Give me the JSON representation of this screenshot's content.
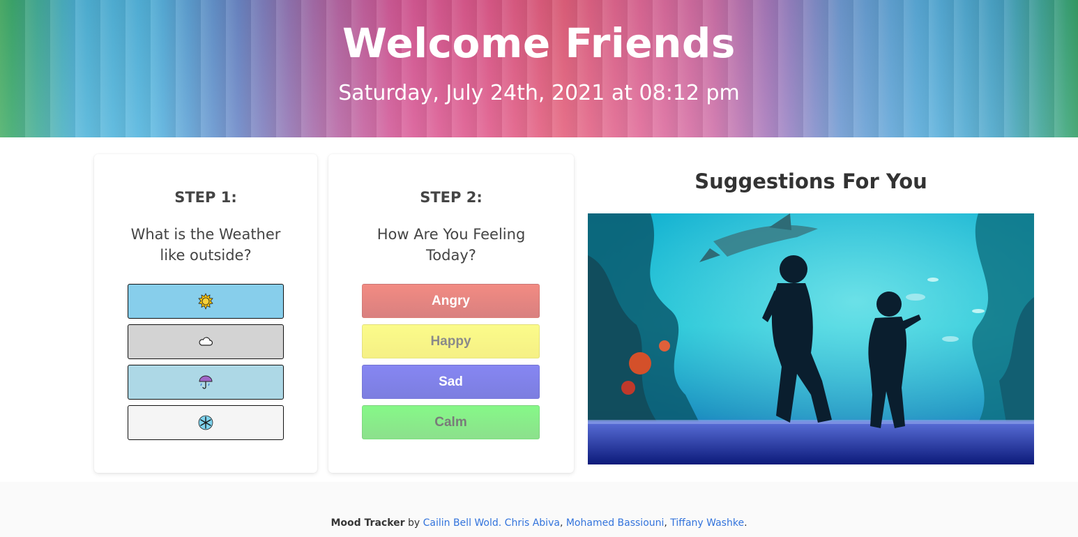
{
  "header": {
    "title": "Welcome Friends",
    "date": "Saturday, July 24th, 2021 at 08:12 pm"
  },
  "step1": {
    "title": "STEP 1:",
    "question_line1": "What is the Weather",
    "question_line2": "like outside?",
    "options": [
      {
        "icon": "sun-icon",
        "glyph": "🌞",
        "color": "#87ceeb"
      },
      {
        "icon": "cloud-icon",
        "glyph": "☁",
        "color": "#d3d3d3"
      },
      {
        "icon": "umbrella-rain-icon",
        "glyph": "☔",
        "color": "#add8e6"
      },
      {
        "icon": "snowflake-icon",
        "glyph": "❄",
        "color": "#f5f5f5"
      }
    ]
  },
  "step2": {
    "title": "STEP 2:",
    "question_line1": "How Are You Feeling",
    "question_line2": "Today?",
    "moods": [
      {
        "label": "Angry",
        "color": "#f28b82"
      },
      {
        "label": "Happy",
        "color": "#fbfb8a"
      },
      {
        "label": "Sad",
        "color": "#8686f2"
      },
      {
        "label": "Calm",
        "color": "#86f888"
      }
    ]
  },
  "suggestions": {
    "title": "Suggestions For You"
  },
  "footer": {
    "app_name": "Mood Tracker",
    "by": "by",
    "authors": [
      "Cailin Bell Wold.",
      "Chris Abiva",
      "Mohamed Bassiouni",
      "Tiffany Washke"
    ],
    "sep1": " ",
    "sep2": ", ",
    "sep3": ", ",
    "end": "."
  },
  "colors": {
    "link": "#3273dc",
    "footer_bg": "#fafafa"
  }
}
